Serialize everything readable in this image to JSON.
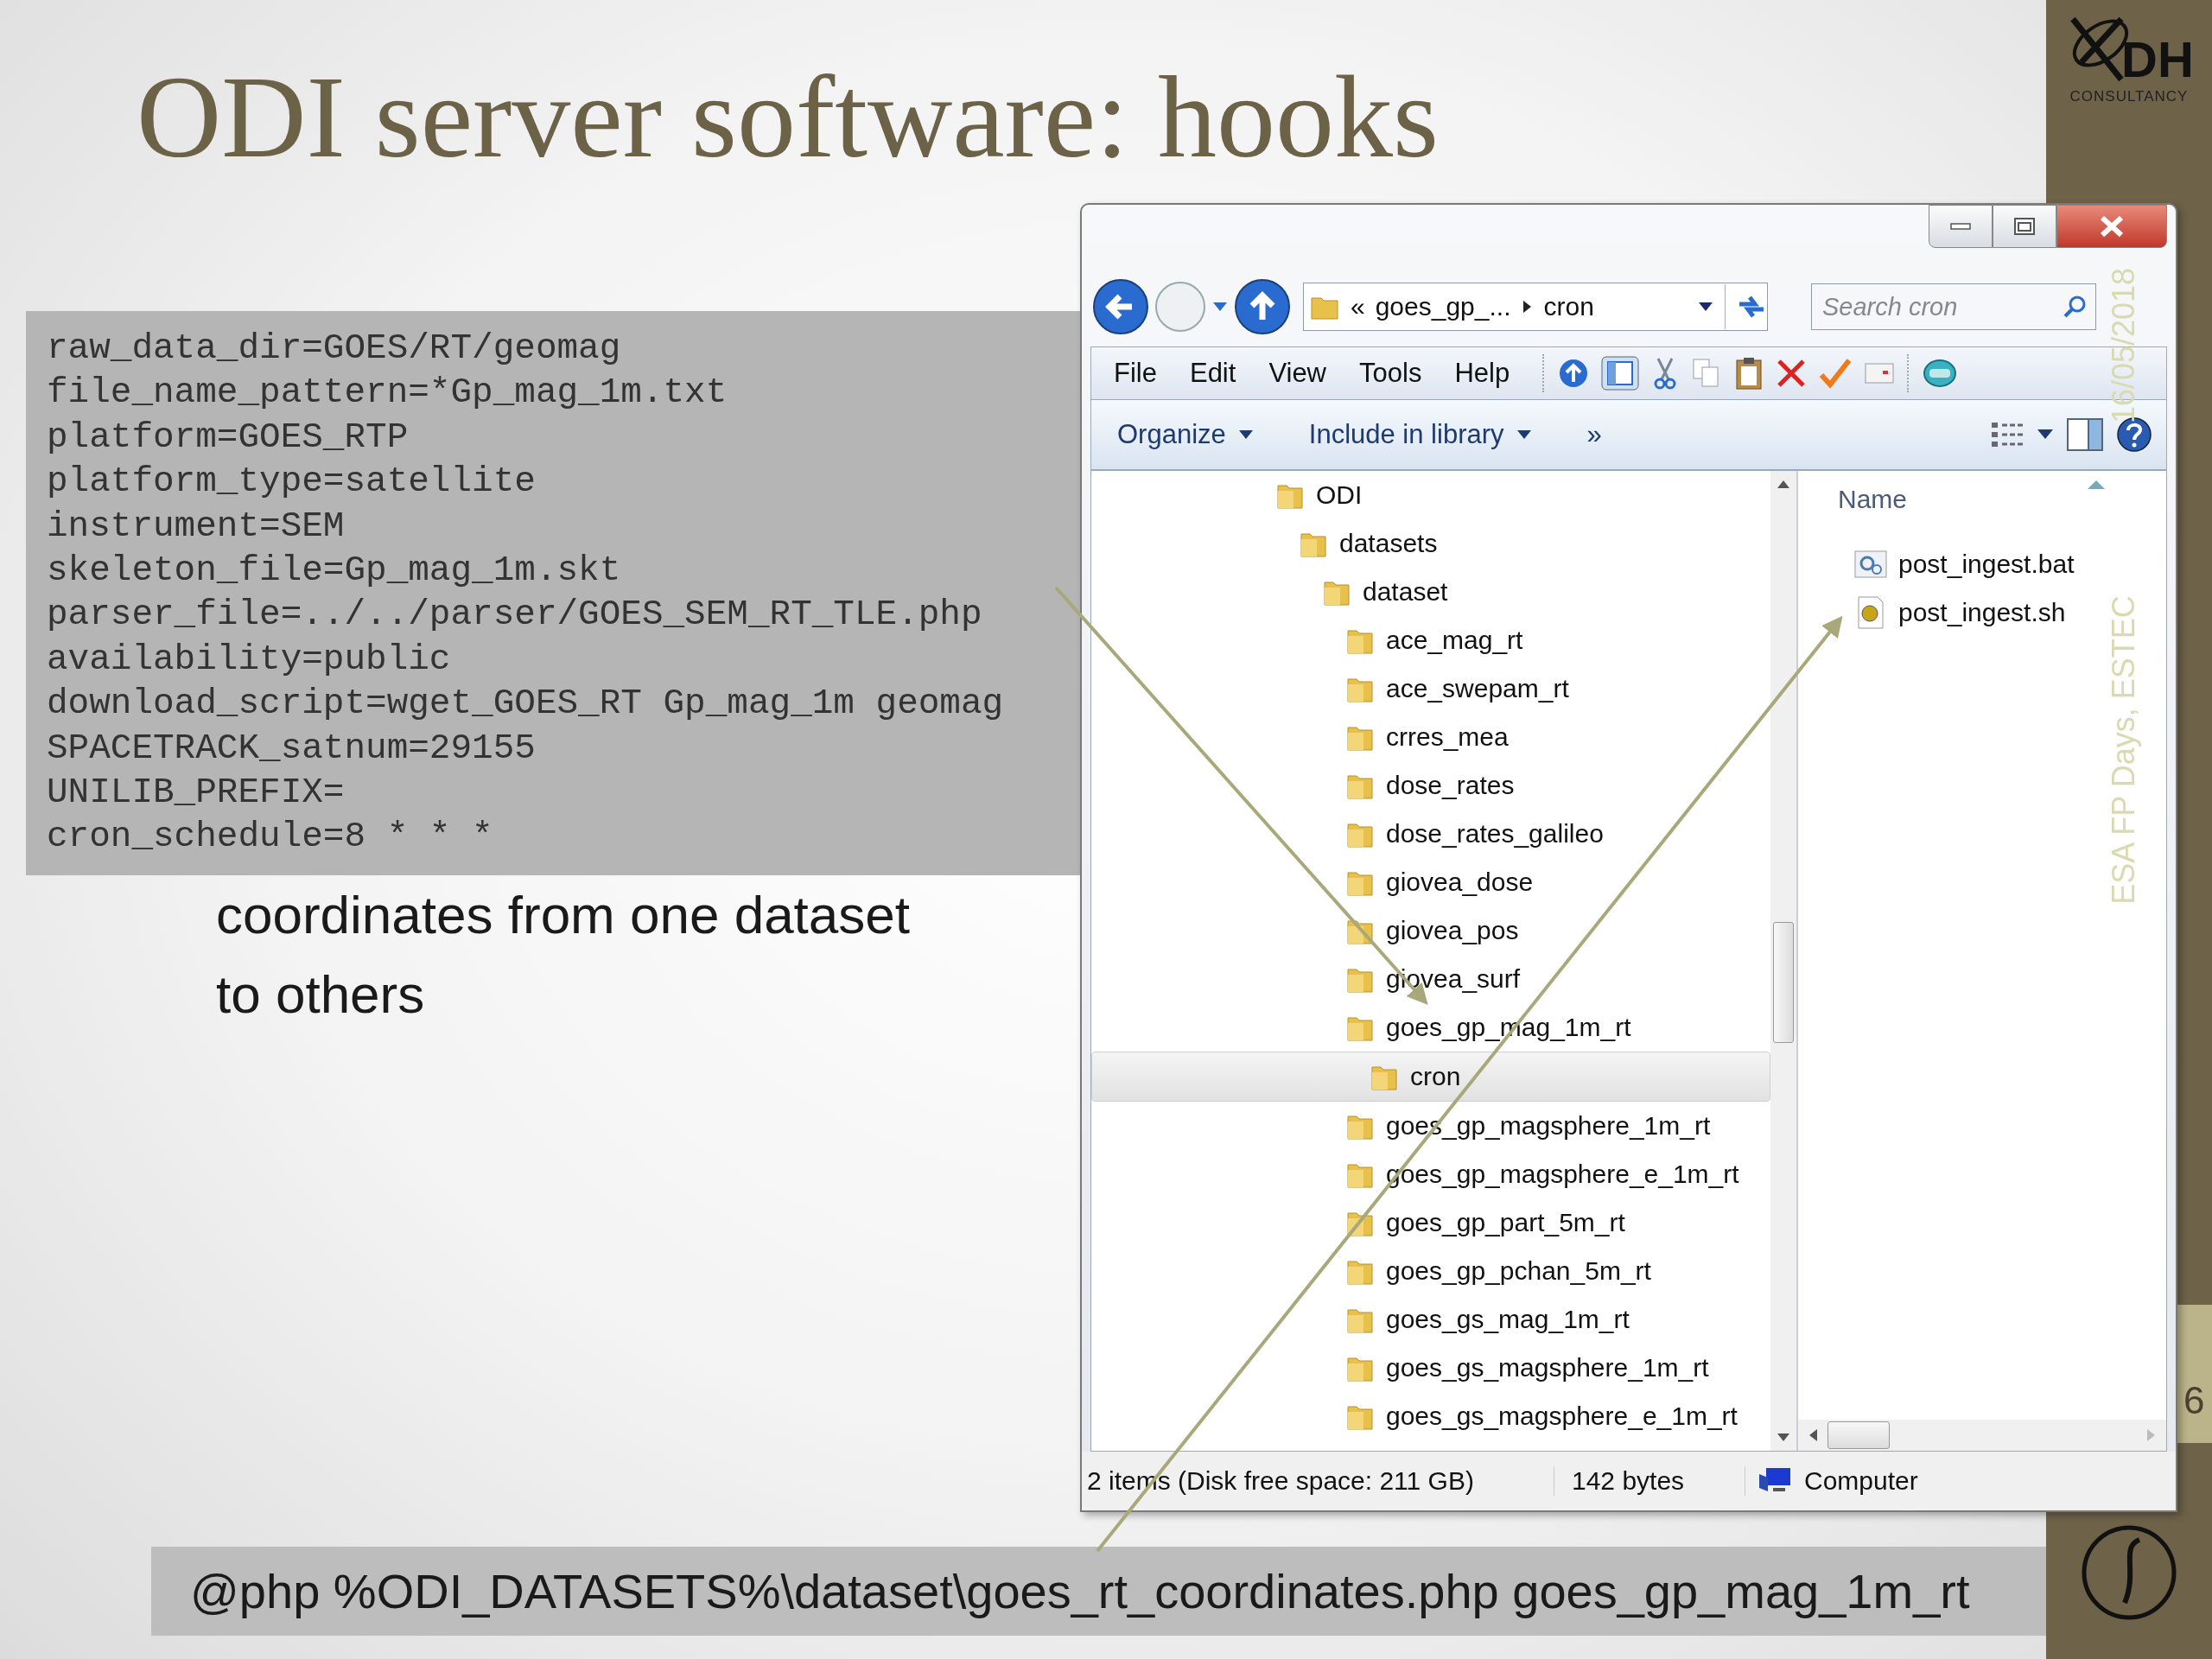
{
  "slide": {
    "title": "ODI server software: hooks",
    "config_lines": [
      "raw_data_dir=GOES/RT/geomag",
      "file_name_pattern=*Gp_mag_1m.txt",
      "platform=GOES_RTP",
      "platform_type=satellite",
      "instrument=SEM",
      "skeleton_file=Gp_mag_1m.skt",
      "parser_file=../../parser/GOES_SEM_RT_TLE.php",
      "availability=public",
      "download_script=wget_GOES_RT Gp_mag_1m geomag",
      "SPACETRACK_satnum=29155",
      "UNILIB_PREFIX=",
      "cron_schedule=8 * * *"
    ],
    "body_lines": [
      "coordinates from one dataset",
      "to others"
    ],
    "command": "@php %ODI_DATASETS%\\dataset\\goes_rt_coordinates.php goes_gp_mag_1m_rt",
    "logo_text": "DH",
    "logo_subtext": "CONSULTANCY",
    "footer_date": "16/05/2018",
    "footer_event": "ESA FP Days, ESTEC",
    "page_number": "6"
  },
  "explorer": {
    "address": {
      "overflow": "«",
      "crumbs": [
        "goes_gp_...",
        "cron"
      ]
    },
    "search": {
      "placeholder": "Search cron"
    },
    "menu": [
      "File",
      "Edit",
      "View",
      "Tools",
      "Help"
    ],
    "commands": [
      "Organize",
      "Include in library"
    ],
    "more": "»",
    "tree": [
      {
        "label": "ODI",
        "selected": false,
        "children": [
          {
            "label": "datasets",
            "selected": false,
            "children": [
              {
                "label": "dataset",
                "selected": false,
                "children": [
                  {
                    "label": "ace_mag_rt",
                    "selected": false
                  },
                  {
                    "label": "ace_swepam_rt",
                    "selected": false
                  },
                  {
                    "label": "crres_mea",
                    "selected": false
                  },
                  {
                    "label": "dose_rates",
                    "selected": false
                  },
                  {
                    "label": "dose_rates_galileo",
                    "selected": false
                  },
                  {
                    "label": "giovea_dose",
                    "selected": false
                  },
                  {
                    "label": "giovea_pos",
                    "selected": false
                  },
                  {
                    "label": "giovea_surf",
                    "selected": false
                  },
                  {
                    "label": "goes_gp_mag_1m_rt",
                    "selected": false,
                    "children": [
                      {
                        "label": "cron",
                        "selected": true
                      }
                    ]
                  },
                  {
                    "label": "goes_gp_magsphere_1m_rt",
                    "selected": false
                  },
                  {
                    "label": "goes_gp_magsphere_e_1m_rt",
                    "selected": false
                  },
                  {
                    "label": "goes_gp_part_5m_rt",
                    "selected": false
                  },
                  {
                    "label": "goes_gp_pchan_5m_rt",
                    "selected": false
                  },
                  {
                    "label": "goes_gs_mag_1m_rt",
                    "selected": false
                  },
                  {
                    "label": "goes_gs_magsphere_1m_rt",
                    "selected": false
                  },
                  {
                    "label": "goes_gs_magsphere_e_1m_rt",
                    "selected": false
                  }
                ]
              }
            ]
          }
        ]
      }
    ],
    "column_header": "Name",
    "files": [
      {
        "name": "post_ingest.bat",
        "kind": "batch"
      },
      {
        "name": "post_ingest.sh",
        "kind": "script"
      }
    ],
    "status": {
      "items": "2 items (Disk free space: 211 GB)",
      "size": "142 bytes",
      "location": "Computer"
    }
  }
}
